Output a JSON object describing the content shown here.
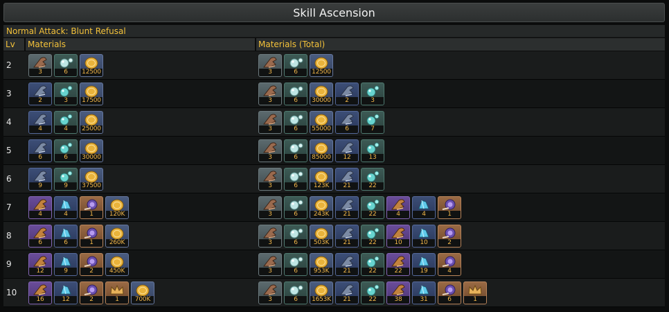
{
  "title": "Skill Ascension",
  "skill_name": "Normal Attack: Blunt Refusal",
  "headers": {
    "lv": "Lv",
    "materials": "Materials",
    "materials_total": "Materials (Total)"
  },
  "icons": {
    "pincer_1": "crab-pincer-icon",
    "pearl_1": "pearl-icon",
    "mora": "mora-coin-icon",
    "pincer_2": "blue-pincer-icon",
    "pearl_2": "teal-pearl-icon",
    "pincer_3": "purple-pincer-icon",
    "pearl_3": "crystal-pearl-icon",
    "boss": "snail-shell-icon",
    "crown": "crown-icon"
  },
  "rows": [
    {
      "lv": "2",
      "materials": [
        {
          "kind": "pincer_1",
          "count": "3"
        },
        {
          "kind": "pearl_1",
          "count": "6"
        },
        {
          "kind": "mora",
          "count": "12500"
        }
      ],
      "total": [
        {
          "kind": "pincer_1",
          "count": "3"
        },
        {
          "kind": "pearl_1",
          "count": "6"
        },
        {
          "kind": "mora",
          "count": "12500"
        }
      ]
    },
    {
      "lv": "3",
      "materials": [
        {
          "kind": "pincer_2",
          "count": "2"
        },
        {
          "kind": "pearl_2",
          "count": "3"
        },
        {
          "kind": "mora",
          "count": "17500"
        }
      ],
      "total": [
        {
          "kind": "pincer_1",
          "count": "3"
        },
        {
          "kind": "pearl_1",
          "count": "6"
        },
        {
          "kind": "mora",
          "count": "30000"
        },
        {
          "kind": "pincer_2",
          "count": "2"
        },
        {
          "kind": "pearl_2",
          "count": "3"
        }
      ]
    },
    {
      "lv": "4",
      "materials": [
        {
          "kind": "pincer_2",
          "count": "4"
        },
        {
          "kind": "pearl_2",
          "count": "4"
        },
        {
          "kind": "mora",
          "count": "25000"
        }
      ],
      "total": [
        {
          "kind": "pincer_1",
          "count": "3"
        },
        {
          "kind": "pearl_1",
          "count": "6"
        },
        {
          "kind": "mora",
          "count": "55000"
        },
        {
          "kind": "pincer_2",
          "count": "6"
        },
        {
          "kind": "pearl_2",
          "count": "7"
        }
      ]
    },
    {
      "lv": "5",
      "materials": [
        {
          "kind": "pincer_2",
          "count": "6"
        },
        {
          "kind": "pearl_2",
          "count": "6"
        },
        {
          "kind": "mora",
          "count": "30000"
        }
      ],
      "total": [
        {
          "kind": "pincer_1",
          "count": "3"
        },
        {
          "kind": "pearl_1",
          "count": "6"
        },
        {
          "kind": "mora",
          "count": "85000"
        },
        {
          "kind": "pincer_2",
          "count": "12"
        },
        {
          "kind": "pearl_2",
          "count": "13"
        }
      ]
    },
    {
      "lv": "6",
      "materials": [
        {
          "kind": "pincer_2",
          "count": "9"
        },
        {
          "kind": "pearl_2",
          "count": "9"
        },
        {
          "kind": "mora",
          "count": "37500"
        }
      ],
      "total": [
        {
          "kind": "pincer_1",
          "count": "3"
        },
        {
          "kind": "pearl_1",
          "count": "6"
        },
        {
          "kind": "mora",
          "count": "123K"
        },
        {
          "kind": "pincer_2",
          "count": "21"
        },
        {
          "kind": "pearl_2",
          "count": "22"
        }
      ]
    },
    {
      "lv": "7",
      "materials": [
        {
          "kind": "pincer_3",
          "count": "4"
        },
        {
          "kind": "pearl_3",
          "count": "4"
        },
        {
          "kind": "boss",
          "count": "1"
        },
        {
          "kind": "mora",
          "count": "120K"
        }
      ],
      "total": [
        {
          "kind": "pincer_1",
          "count": "3"
        },
        {
          "kind": "pearl_1",
          "count": "6"
        },
        {
          "kind": "mora",
          "count": "243K"
        },
        {
          "kind": "pincer_2",
          "count": "21"
        },
        {
          "kind": "pearl_2",
          "count": "22"
        },
        {
          "kind": "pincer_3",
          "count": "4"
        },
        {
          "kind": "pearl_3",
          "count": "4"
        },
        {
          "kind": "boss",
          "count": "1"
        }
      ]
    },
    {
      "lv": "8",
      "materials": [
        {
          "kind": "pincer_3",
          "count": "6"
        },
        {
          "kind": "pearl_3",
          "count": "6"
        },
        {
          "kind": "boss",
          "count": "1"
        },
        {
          "kind": "mora",
          "count": "260K"
        }
      ],
      "total": [
        {
          "kind": "pincer_1",
          "count": "3"
        },
        {
          "kind": "pearl_1",
          "count": "6"
        },
        {
          "kind": "mora",
          "count": "503K"
        },
        {
          "kind": "pincer_2",
          "count": "21"
        },
        {
          "kind": "pearl_2",
          "count": "22"
        },
        {
          "kind": "pincer_3",
          "count": "10"
        },
        {
          "kind": "pearl_3",
          "count": "10"
        },
        {
          "kind": "boss",
          "count": "2"
        }
      ]
    },
    {
      "lv": "9",
      "materials": [
        {
          "kind": "pincer_3",
          "count": "12"
        },
        {
          "kind": "pearl_3",
          "count": "9"
        },
        {
          "kind": "boss",
          "count": "2"
        },
        {
          "kind": "mora",
          "count": "450K"
        }
      ],
      "total": [
        {
          "kind": "pincer_1",
          "count": "3"
        },
        {
          "kind": "pearl_1",
          "count": "6"
        },
        {
          "kind": "mora",
          "count": "953K"
        },
        {
          "kind": "pincer_2",
          "count": "21"
        },
        {
          "kind": "pearl_2",
          "count": "22"
        },
        {
          "kind": "pincer_3",
          "count": "22"
        },
        {
          "kind": "pearl_3",
          "count": "19"
        },
        {
          "kind": "boss",
          "count": "4"
        }
      ]
    },
    {
      "lv": "10",
      "materials": [
        {
          "kind": "pincer_3",
          "count": "16"
        },
        {
          "kind": "pearl_3",
          "count": "12"
        },
        {
          "kind": "boss",
          "count": "2"
        },
        {
          "kind": "crown",
          "count": "1"
        },
        {
          "kind": "mora",
          "count": "700K"
        }
      ],
      "total": [
        {
          "kind": "pincer_1",
          "count": "3"
        },
        {
          "kind": "pearl_1",
          "count": "6"
        },
        {
          "kind": "mora",
          "count": "1653K"
        },
        {
          "kind": "pincer_2",
          "count": "21"
        },
        {
          "kind": "pearl_2",
          "count": "22"
        },
        {
          "kind": "pincer_3",
          "count": "38"
        },
        {
          "kind": "pearl_3",
          "count": "31"
        },
        {
          "kind": "boss",
          "count": "6"
        },
        {
          "kind": "crown",
          "count": "1"
        }
      ]
    }
  ]
}
